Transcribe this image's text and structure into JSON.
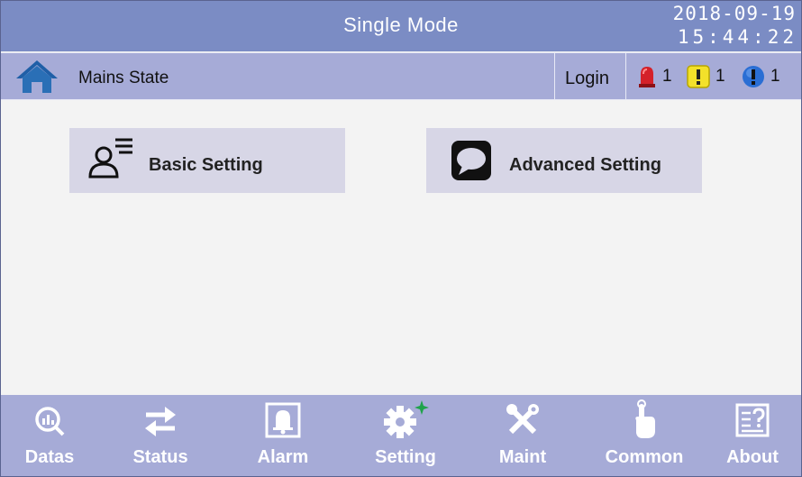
{
  "header": {
    "title": "Single Mode",
    "date": "2018-09-19",
    "time": "15:44:22"
  },
  "status": {
    "state": "Mains State",
    "login": "Login",
    "alarms": [
      {
        "icon": "red-siren-icon",
        "count": "1",
        "color": "#d4212a"
      },
      {
        "icon": "yellow-warning-icon",
        "count": "1",
        "color": "#f3e12a"
      },
      {
        "icon": "blue-info-icon",
        "count": "1",
        "color": "#2a6ed4"
      }
    ]
  },
  "main": {
    "buttons": [
      {
        "label": "Basic Setting",
        "icon": "user-list-icon"
      },
      {
        "label": "Advanced Setting",
        "icon": "speech-bubble-icon"
      }
    ]
  },
  "nav": {
    "items": [
      {
        "label": "Datas",
        "icon": "chart-magnifier-icon"
      },
      {
        "label": "Status",
        "icon": "swap-arrows-icon"
      },
      {
        "label": "Alarm",
        "icon": "bell-icon"
      },
      {
        "label": "Setting",
        "icon": "gear-icon",
        "active": true
      },
      {
        "label": "Maint",
        "icon": "tools-icon"
      },
      {
        "label": "Common",
        "icon": "touch-pointer-icon"
      },
      {
        "label": "About",
        "icon": "help-book-icon"
      }
    ]
  },
  "colors": {
    "title_bar": "#7b8cc4",
    "status_bar": "#a6abd7",
    "button": "#d7d6e6",
    "active_marker": "#1fa34a"
  }
}
